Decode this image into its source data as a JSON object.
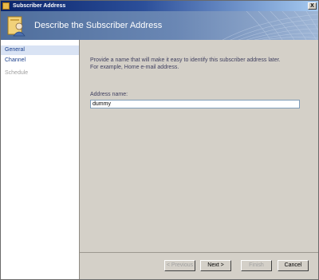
{
  "window": {
    "title": "Subscriber Address",
    "close_glyph": "X"
  },
  "banner": {
    "title": "Describe the Subscriber Address",
    "icon": "subscriber-address-icon"
  },
  "sidebar": {
    "items": [
      {
        "label": "General",
        "state": "selected"
      },
      {
        "label": "Channel",
        "state": "enabled"
      },
      {
        "label": "Schedule",
        "state": "disabled"
      }
    ]
  },
  "content": {
    "description_line1": "Provide a name that will make it easy to identify this subscriber address later.",
    "description_line2": "For example, Home e-mail address.",
    "address_label": "Address name:",
    "address_value": "dummy"
  },
  "buttons": {
    "previous": "< Previous",
    "next": "Next >",
    "finish": "Finish",
    "cancel": "Cancel"
  },
  "colors": {
    "title_bar": "#0a246a",
    "banner": "#6a87b4",
    "selected_nav": "#d9e3f4",
    "face": "#d4d0c8"
  }
}
